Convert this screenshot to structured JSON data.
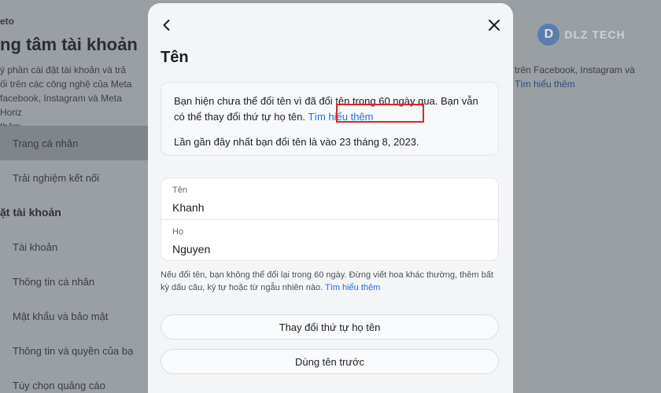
{
  "background": {
    "brand": "eto",
    "title": "ng tâm tài khoản",
    "description": "ý phần cài đặt tài khoản và trả\nối trên các công nghệ của Meta\nfacebook, Instagram và Meta Horiz\nthêm",
    "right_text": "trên Facebook, Instagram và",
    "right_text2": "Tìm hiểu thêm",
    "nav_items": [
      {
        "label": "Trang cá nhân",
        "active": true
      },
      {
        "label": "Trải nghiệm kết nối",
        "active": false
      }
    ],
    "section_title": "ặt tài khoản",
    "settings_items": [
      {
        "label": "Tài khoản"
      },
      {
        "label": "Thông tin cá nhân"
      },
      {
        "label": "Mật khẩu và bảo mật"
      },
      {
        "label": "Thông tin và quyền của bạ"
      },
      {
        "label": "Tùy chọn quảng cáo"
      }
    ],
    "watermark": {
      "mark": "D",
      "text": "DLZ TECH"
    }
  },
  "modal": {
    "title": "Tên",
    "info": {
      "text": "Bạn hiện chưa thể đổi tên vì đã đổi tên trong 60 ngày qua. Bạn vẫn có thể thay đổi thứ tự họ tên.",
      "link": "Tìm hiểu thêm",
      "last_changed": "Lần gần đây nhất bạn đổi tên là vào 23 tháng 8, 2023."
    },
    "fields": [
      {
        "label": "Tên",
        "value": "Khanh"
      },
      {
        "label": "Họ",
        "value": "Nguyen"
      }
    ],
    "notice": {
      "text": "Nếu đổi tên, bạn không thể đổi lại trong 60 ngày. Đừng viết hoa khác thường, thêm bất kỳ dấu câu, ký tự hoặc từ ngẫu nhiên nào.",
      "link": "Tìm hiểu thêm"
    },
    "buttons": {
      "reorder": "Thay đổi thứ tự họ tên",
      "previous": "Dùng tên trước"
    }
  },
  "colors": {
    "link": "#216fdb",
    "highlight": "#d9262b",
    "modal_bg": "#f4f5f7"
  }
}
